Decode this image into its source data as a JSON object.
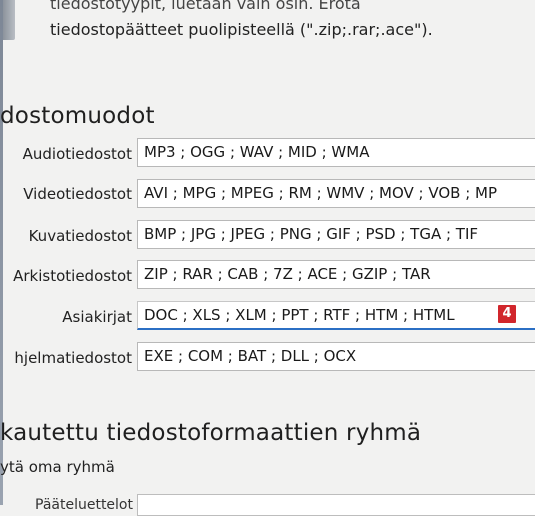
{
  "description": {
    "line1": "tiedostotyypit, luetaan vain osin. Erota",
    "line2": "tiedostopäätteet puolipisteellä (\".zip;.rar;.ace\")."
  },
  "file_formats": {
    "title": "dostomuodot",
    "rows": [
      {
        "label": "Audiotiedostot",
        "value": "MP3 ; OGG ; WAV ; MID ; WMA"
      },
      {
        "label": "Videotiedostot",
        "value": "AVI ; MPG ; MPEG ; RM ; WMV ; MOV ; VOB ; MP"
      },
      {
        "label": "Kuvatiedostot",
        "value": "BMP ; JPG ; JPEG ; PNG ; GIF ; PSD ; TGA ; TIF"
      },
      {
        "label": "Arkistotiedostot",
        "value": "ZIP ; RAR ; CAB ; 7Z ; ACE ; GZIP ; TAR"
      },
      {
        "label": "Asiakirjat",
        "value": "DOC ; XLS ; XLM ; PPT ; RTF ; HTM ; HTML"
      },
      {
        "label": "hjelmatiedostot",
        "value": "EXE ; COM ; BAT ; DLL ; OCX"
      }
    ]
  },
  "badge": "4",
  "custom_group": {
    "title": "kautettu tiedostoformaattien ryhmä",
    "subtitle": "ytä oma ryhmä",
    "partial_label": "Pääteluettelot"
  }
}
